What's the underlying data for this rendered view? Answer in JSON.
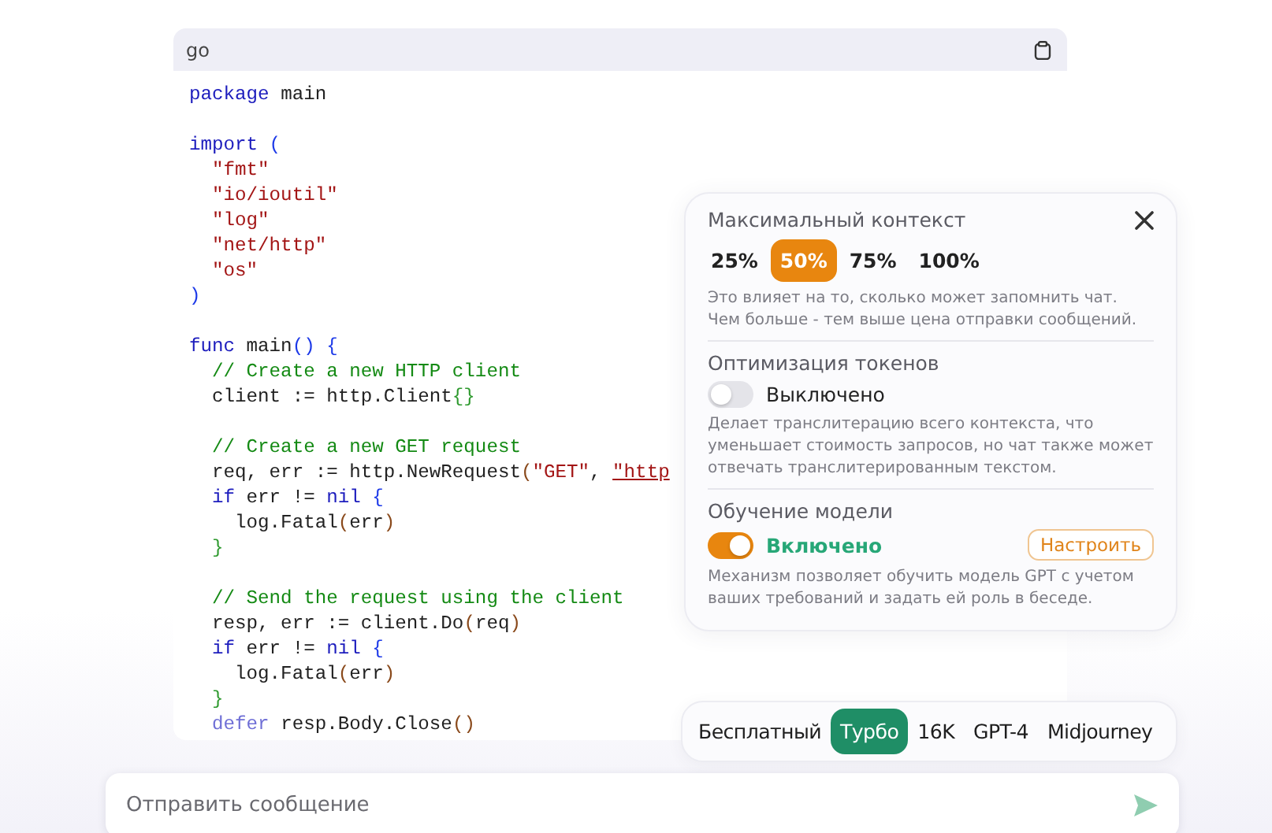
{
  "code": {
    "language": "go",
    "blocks": [
      [
        {
          "tokens": [
            {
              "kind": "kw",
              "text": "package"
            },
            {
              "kind": "txt",
              "text": " main"
            }
          ]
        }
      ],
      [
        {
          "tokens": [
            {
              "kind": "kw",
              "text": "import"
            },
            {
              "kind": "b1",
              "text": " ("
            }
          ]
        },
        {
          "tokens": [
            {
              "kind": "str",
              "text": "  \"fmt\""
            }
          ]
        },
        {
          "tokens": [
            {
              "kind": "str",
              "text": "  \"io/ioutil\""
            }
          ]
        },
        {
          "tokens": [
            {
              "kind": "str",
              "text": "  \"log\""
            }
          ]
        },
        {
          "tokens": [
            {
              "kind": "str",
              "text": "  \"net/http\""
            }
          ]
        },
        {
          "tokens": [
            {
              "kind": "str",
              "text": "  \"os\""
            }
          ]
        },
        {
          "tokens": [
            {
              "kind": "b1",
              "text": ")"
            }
          ]
        }
      ],
      [
        {
          "tokens": [
            {
              "kind": "kw",
              "text": "func"
            },
            {
              "kind": "txt",
              "text": " main"
            },
            {
              "kind": "b1",
              "text": "()"
            },
            {
              "kind": "b1",
              "text": " {"
            }
          ]
        },
        {
          "tokens": [
            {
              "kind": "com",
              "text": "  // Create a new HTTP client"
            }
          ]
        },
        {
          "tokens": [
            {
              "kind": "txt",
              "text": "  client := http.Client"
            },
            {
              "kind": "b2",
              "text": "{}"
            }
          ]
        }
      ],
      [
        {
          "tokens": [
            {
              "kind": "com",
              "text": "  // Create a new GET request"
            }
          ]
        },
        {
          "tokens": [
            {
              "kind": "txt",
              "text": "  req, err := http.NewRequest"
            },
            {
              "kind": "b3",
              "text": "("
            },
            {
              "kind": "str",
              "text": "\"GET\""
            },
            {
              "kind": "txt",
              "text": ", "
            },
            {
              "kind": "link",
              "text": "\"http"
            }
          ]
        },
        {
          "tokens": [
            {
              "kind": "kw",
              "text": "  if"
            },
            {
              "kind": "txt",
              "text": " err != "
            },
            {
              "kind": "kw",
              "text": "nil"
            },
            {
              "kind": "b1",
              "text": " {"
            }
          ]
        },
        {
          "tokens": [
            {
              "kind": "txt",
              "text": "    log.Fatal"
            },
            {
              "kind": "b3",
              "text": "("
            },
            {
              "kind": "txt",
              "text": "err"
            },
            {
              "kind": "b3",
              "text": ")"
            }
          ]
        },
        {
          "tokens": [
            {
              "kind": "b2",
              "text": "  }"
            }
          ]
        }
      ],
      [
        {
          "tokens": [
            {
              "kind": "com",
              "text": "  // Send the request using the client"
            }
          ]
        },
        {
          "tokens": [
            {
              "kind": "txt",
              "text": "  resp, err := client.Do"
            },
            {
              "kind": "b3",
              "text": "("
            },
            {
              "kind": "txt",
              "text": "req"
            },
            {
              "kind": "b3",
              "text": ")"
            }
          ]
        },
        {
          "tokens": [
            {
              "kind": "kw",
              "text": "  if"
            },
            {
              "kind": "txt",
              "text": " err != "
            },
            {
              "kind": "kw",
              "text": "nil"
            },
            {
              "kind": "b1",
              "text": " {"
            }
          ]
        },
        {
          "tokens": [
            {
              "kind": "txt",
              "text": "    log.Fatal"
            },
            {
              "kind": "b3",
              "text": "("
            },
            {
              "kind": "txt",
              "text": "err"
            },
            {
              "kind": "b3",
              "text": ")"
            }
          ]
        },
        {
          "tokens": [
            {
              "kind": "b2",
              "text": "  }"
            }
          ]
        },
        {
          "tokens": [
            {
              "kind": "kw2",
              "text": "  defer"
            },
            {
              "kind": "txt",
              "text": " resp.Body.Close"
            },
            {
              "kind": "b3",
              "text": "()"
            }
          ]
        }
      ]
    ]
  },
  "settings": {
    "sections": [
      {
        "kind": "choices",
        "title": "Максимальный контекст",
        "options": [
          {
            "label": "25%",
            "selected": false
          },
          {
            "label": "50%",
            "selected": true
          },
          {
            "label": "75%",
            "selected": false
          },
          {
            "label": "100%",
            "selected": false
          }
        ],
        "description": "Это влияет на то, сколько может запомнить чат. Чем больше - тем выше цена отправки сообщений."
      },
      {
        "kind": "toggle",
        "title": "Оптимизация токенов",
        "on": false,
        "status": "Выключено",
        "description": "Делает транслитерацию всего контекста, что уменьшает стоимость запросов, но чат также может отвечать транслитерированным текстом."
      },
      {
        "kind": "toggle",
        "title": "Обучение модели",
        "on": true,
        "status": "Включено",
        "action": "Настроить",
        "description": "Механизм позволяет обучить модель GPT с учетом ваших требований и задать ей роль в беседе."
      }
    ]
  },
  "models": [
    {
      "label": "Бесплатный",
      "selected": false
    },
    {
      "label": "Турбо",
      "selected": true
    },
    {
      "label": "16K",
      "selected": false
    },
    {
      "label": "GPT-4",
      "selected": false
    },
    {
      "label": "Midjourney",
      "selected": false
    }
  ],
  "message": {
    "placeholder": "Отправить сообщение"
  }
}
